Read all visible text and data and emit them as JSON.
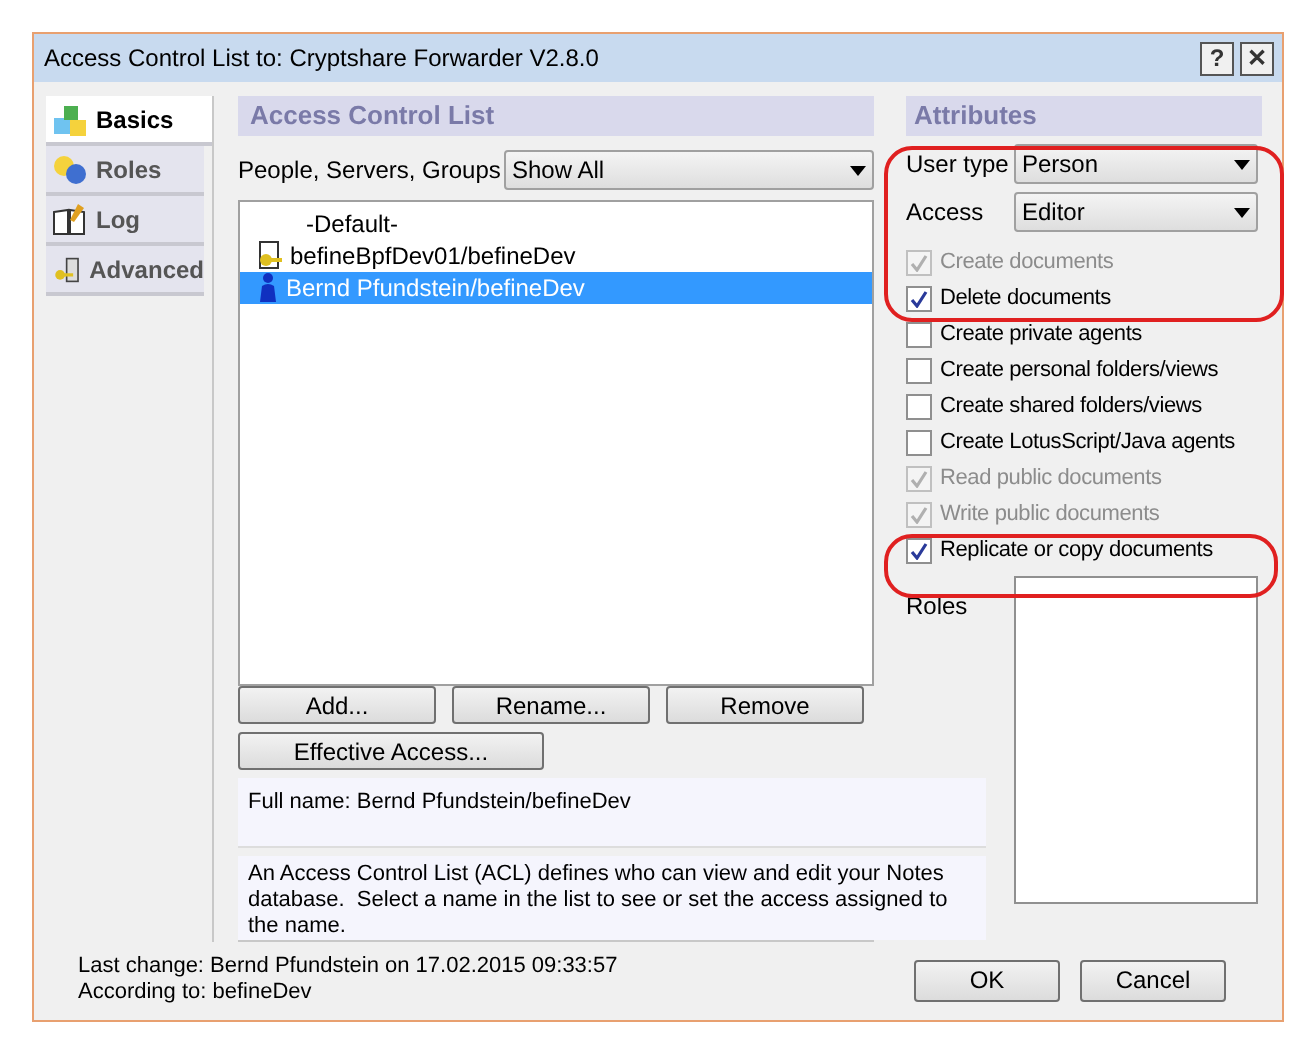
{
  "window": {
    "title": "Access Control List to: Cryptshare Forwarder V2.8.0",
    "buttons": [
      "?",
      "✕"
    ]
  },
  "sidebar": {
    "tabs": [
      {
        "label": "Basics",
        "selected": true
      },
      {
        "label": "Roles",
        "selected": false
      },
      {
        "label": "Log",
        "selected": false
      },
      {
        "label": "Advanced",
        "selected": false
      }
    ]
  },
  "acl": {
    "header": "Access Control List",
    "filter_label": "People, Servers, Groups",
    "filter_value": "Show All",
    "entries": [
      {
        "name": "-Default-",
        "kind": "default",
        "selected": false
      },
      {
        "name": "befineBpfDev01/befineDev",
        "kind": "server",
        "selected": false
      },
      {
        "name": "Bernd Pfundstein/befineDev",
        "kind": "person",
        "selected": true
      }
    ],
    "buttons": [
      "Add...",
      "Rename...",
      "Remove"
    ],
    "effective_access_button": "Effective Access...",
    "full_name": "Full name: Bernd Pfundstein/befineDev",
    "description": "An Access Control List (ACL) defines who can view and edit your Notes database.  Select a name in the list to see or set the access assigned to the name."
  },
  "attributes": {
    "header": "Attributes",
    "fields": [
      {
        "label": "User type",
        "value": "Person"
      },
      {
        "label": "Access",
        "value": "Editor"
      }
    ],
    "checkboxes": [
      {
        "label": "Create documents",
        "checked": true,
        "disabled": true
      },
      {
        "label": "Delete documents",
        "checked": true,
        "disabled": false
      },
      {
        "label": "Create private agents",
        "checked": false,
        "disabled": false
      },
      {
        "label": "Create personal folders/views",
        "checked": false,
        "disabled": false
      },
      {
        "label": "Create shared folders/views",
        "checked": false,
        "disabled": false
      },
      {
        "label": "Create LotusScript/Java agents",
        "checked": false,
        "disabled": false
      },
      {
        "label": "Read public documents",
        "checked": true,
        "disabled": true
      },
      {
        "label": "Write public documents",
        "checked": true,
        "disabled": true
      },
      {
        "label": "Replicate or copy documents",
        "checked": true,
        "disabled": false
      }
    ],
    "roles_label": "Roles"
  },
  "footer": {
    "last_change": "Last change: Bernd Pfundstein on 17.02.2015 09:33:57",
    "according_to": "According to: befineDev",
    "buttons": [
      "OK",
      "Cancel"
    ]
  }
}
